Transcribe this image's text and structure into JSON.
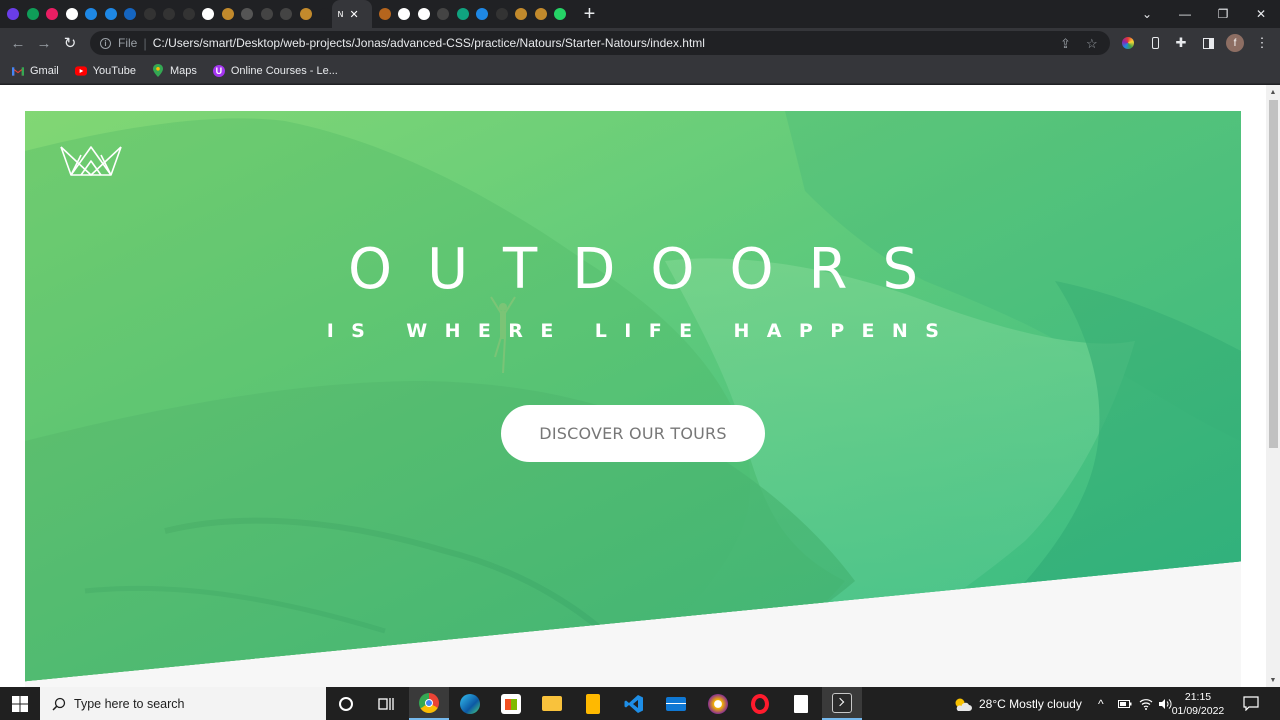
{
  "tabs": [
    {
      "letter": "C",
      "color": "#6a3de8"
    },
    {
      "letter": "F",
      "color": "#0f9d58"
    },
    {
      "letter": "K",
      "color": "#e91e63"
    },
    {
      "letter": "C",
      "color": "#ffffff"
    },
    {
      "letter": "F",
      "color": "#1e88e5"
    },
    {
      "letter": "D",
      "color": "#1e88e5"
    },
    {
      "letter": "L",
      "color": "#1565c0"
    },
    {
      "letter": "C",
      "color": "#333333"
    },
    {
      "letter": "C",
      "color": "#333333"
    },
    {
      "letter": "C",
      "color": "#333333"
    },
    {
      "letter": "k",
      "color": "#ffffff"
    },
    {
      "letter": "L",
      "color": "#c28a2c"
    },
    {
      "letter": "B",
      "color": "#555555"
    },
    {
      "letter": "L",
      "color": "#444444"
    },
    {
      "letter": "L",
      "color": "#444444"
    },
    {
      "letter": "F",
      "color": "#c28a2c"
    },
    {
      "letter": "B",
      "color": "#202124"
    }
  ],
  "active_tab": {
    "title": "N",
    "close": "✕"
  },
  "tabs_after": [
    {
      "letter": "n",
      "color": "#b5651d"
    },
    {
      "letter": "T",
      "color": "#ffffff"
    },
    {
      "letter": "F",
      "color": "#ffffff"
    },
    {
      "letter": "1",
      "color": "#444444"
    },
    {
      "letter": "C",
      "color": "#10a37f"
    },
    {
      "letter": "S",
      "color": "#1e88e5"
    },
    {
      "letter": "C",
      "color": "#333333"
    },
    {
      "letter": "L",
      "color": "#c28a2c"
    },
    {
      "letter": "L",
      "color": "#c28a2c"
    },
    {
      "letter": "(",
      "color": "#25d366"
    }
  ],
  "window": {
    "new_tab": "+",
    "dropdown": "⌄",
    "minimize": "—",
    "maximize": "❐",
    "close": "✕"
  },
  "toolbar": {
    "back": "←",
    "forward": "→",
    "reload": "↻",
    "scheme": "File",
    "url": "C:/Users/smart/Desktop/web-projects/Jonas/advanced-CSS/practice/Natours/Starter-Natours/index.html",
    "profile_initial": "f"
  },
  "bookmarks": [
    {
      "label": "Gmail",
      "icon": "gmail-icon",
      "color": "#ea4335"
    },
    {
      "label": "YouTube",
      "icon": "youtube-icon",
      "color": "#ff0000"
    },
    {
      "label": "Maps",
      "icon": "maps-icon",
      "color": "#34a853"
    },
    {
      "label": "Online Courses - Le...",
      "icon": "udemy-icon",
      "color": "#a435f0"
    }
  ],
  "hero": {
    "heading_main": "OUTDOORS",
    "heading_sub": "IS WHERE LIFE HAPPENS",
    "cta": "DISCOVER OUR TOURS",
    "gradient_start": "#7ed56f",
    "gradient_end": "#28b485"
  },
  "taskbar": {
    "search_placeholder": "Type here to search",
    "weather": "28°C  Mostly cloudy",
    "time": "21:15",
    "date": "01/09/2022"
  }
}
